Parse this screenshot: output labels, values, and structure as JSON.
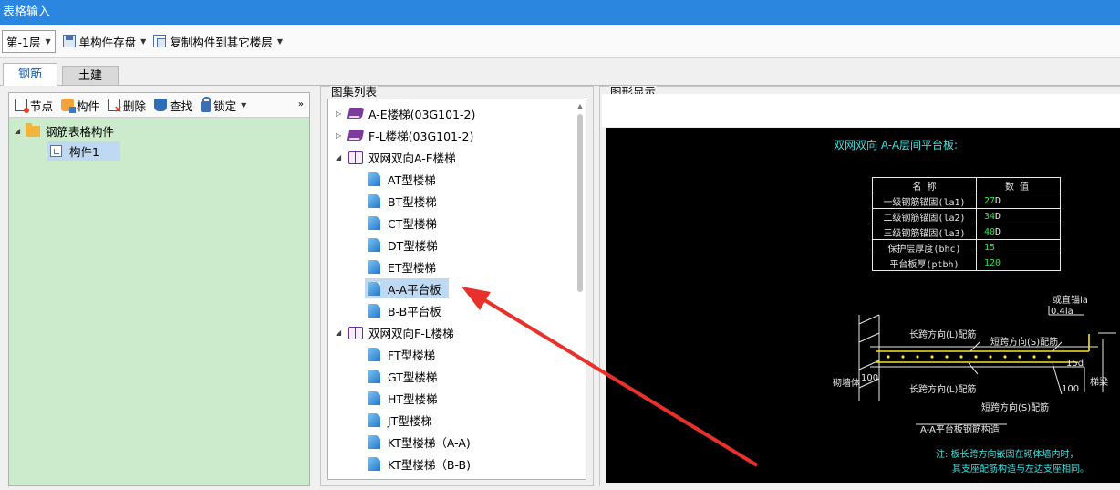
{
  "window": {
    "title": "表格输入"
  },
  "toolbar": {
    "floor": "第-1层",
    "save_component": "单构件存盘",
    "copy_to_floors": "复制构件到其它楼层"
  },
  "tabs": [
    {
      "label": "钢筋",
      "active": true
    },
    {
      "label": "土建",
      "active": false
    }
  ],
  "left_panel": {
    "toolbar": {
      "node": "节点",
      "component": "构件",
      "delete": "删除",
      "find": "查找",
      "lock": "锁定",
      "more": "»"
    },
    "tree": {
      "root": "钢筋表格构件",
      "child": "构件1"
    }
  },
  "middle_panel": {
    "title": "图集列表",
    "items": [
      {
        "label": "A-E楼梯(03G101-2)",
        "level": 0,
        "icon": "book-closed-icon",
        "expanded": false
      },
      {
        "label": "F-L楼梯(03G101-2)",
        "level": 0,
        "icon": "book-closed-icon",
        "expanded": false
      },
      {
        "label": "双网双向A-E楼梯",
        "level": 0,
        "icon": "book-open-icon",
        "expanded": true
      },
      {
        "label": "AT型楼梯",
        "level": 1,
        "icon": "doc-icon"
      },
      {
        "label": "BT型楼梯",
        "level": 1,
        "icon": "doc-icon"
      },
      {
        "label": "CT型楼梯",
        "level": 1,
        "icon": "doc-icon"
      },
      {
        "label": "DT型楼梯",
        "level": 1,
        "icon": "doc-icon"
      },
      {
        "label": "ET型楼梯",
        "level": 1,
        "icon": "doc-icon"
      },
      {
        "label": "A-A平台板",
        "level": 1,
        "icon": "doc-icon",
        "selected": true
      },
      {
        "label": "B-B平台板",
        "level": 1,
        "icon": "doc-icon"
      },
      {
        "label": "双网双向F-L楼梯",
        "level": 0,
        "icon": "book-open-icon",
        "expanded": true
      },
      {
        "label": "FT型楼梯",
        "level": 1,
        "icon": "doc-icon"
      },
      {
        "label": "GT型楼梯",
        "level": 1,
        "icon": "doc-icon"
      },
      {
        "label": "HT型楼梯",
        "level": 1,
        "icon": "doc-icon"
      },
      {
        "label": "JT型楼梯",
        "level": 1,
        "icon": "doc-icon"
      },
      {
        "label": "KT型楼梯（A-A)",
        "level": 1,
        "icon": "doc-icon"
      },
      {
        "label": "KT型楼梯（B-B)",
        "level": 1,
        "icon": "doc-icon"
      }
    ]
  },
  "right_panel": {
    "title": "图形显示",
    "drawing": {
      "heading": "双网双向 A-A层间平台板:",
      "table_header": {
        "name": "名  称",
        "value": "数  值"
      },
      "table_rows": [
        {
          "name": "一级钢筋锚固(la1)",
          "value": "27",
          "suffix": "D"
        },
        {
          "name": "二级钢筋锚固(la2)",
          "value": "34",
          "suffix": "D"
        },
        {
          "name": "三级钢筋锚固(la3)",
          "value": "40",
          "suffix": "D"
        },
        {
          "name": "保护层厚度(bhc)",
          "value": "15",
          "suffix": ""
        },
        {
          "name": "平台板厚(ptbh)",
          "value": "120",
          "suffix": ""
        }
      ],
      "labels": {
        "straight_anchor": "或直锚la",
        "anchor_04": "0.4la",
        "long_top": "长跨方向(L)配筋",
        "short_top": "短跨方向(S)配筋",
        "dim_15d": "15d",
        "wall": "砌墙体",
        "dim_100_left": "100",
        "long_bottom": "长跨方向(L)配筋",
        "dim_100_right": "100",
        "beam": "梯梁",
        "short_bottom": "短跨方向(S)配筋",
        "caption": "A-A平台板钢筋构造",
        "note1": "注: 板长跨方向嵌固在砌体墙内时，",
        "note2": "其支座配筋构造与左边支座相同。"
      }
    }
  }
}
